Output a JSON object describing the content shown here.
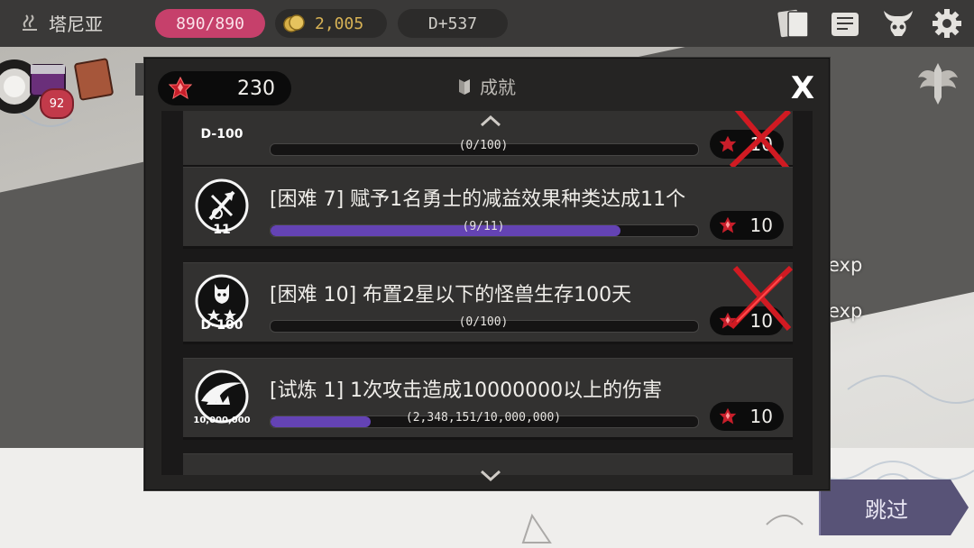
{
  "topbar": {
    "location_icon": "steam-icon",
    "location": "塔尼亚",
    "hp": "890/890",
    "gold": "2,005",
    "day": "D+537",
    "right_icons": [
      "cards-icon",
      "map-scroll-icon",
      "demon-skull-icon",
      "gear-icon"
    ]
  },
  "left": {
    "level": "92",
    "icons": [
      "coin-stack-icon",
      "treasure-chest-icon",
      "spellbook-icon"
    ]
  },
  "side": {
    "exp_labels": [
      "exp",
      "exp"
    ],
    "skip_label": "跳过",
    "emblem": "winged-sword-emblem-icon"
  },
  "modal": {
    "title": "成就",
    "gem_count": "230",
    "close_label": "X",
    "achievements": [
      {
        "badge": "D-100",
        "task": "",
        "progress_text": "(0/100)",
        "progress": 0.0,
        "reward": "10",
        "failed": true
      },
      {
        "badge": "11",
        "task": "[困难 7] 赋予1名勇士的减益效果种类达成11个",
        "progress_text": "(9/11)",
        "progress": 0.818,
        "reward": "10",
        "failed": false
      },
      {
        "badge": "D-100",
        "task": "[困难 10] 布置2星以下的怪兽生存100天",
        "progress_text": "(0/100)",
        "progress": 0.0,
        "reward": "10",
        "failed": true
      },
      {
        "badge": "10,000,000",
        "task": "[试炼 1] 1次攻击造成10000000以上的伤害",
        "progress_text": "(2,348,151/10,000,000)",
        "progress": 0.2348,
        "reward": "10",
        "failed": false
      }
    ]
  },
  "colors": {
    "hp_pill": "#c6406b",
    "gold_text": "#d7b255",
    "progress_fill": "#6443b4",
    "skip_button": "#585377",
    "fail_mark": "#d11a22",
    "gem": "#c81e2a"
  }
}
